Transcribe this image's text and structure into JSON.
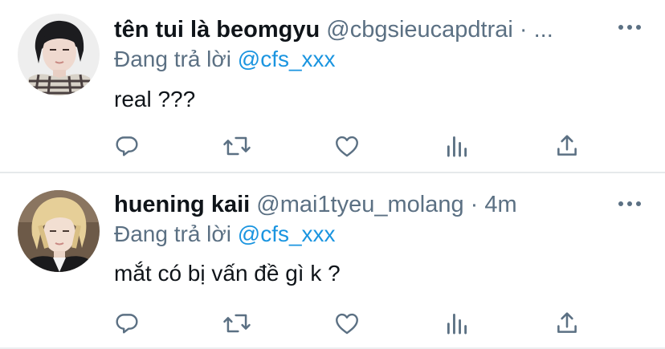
{
  "tweets": [
    {
      "display_name": "tên tui là beomgyu",
      "handle": "@cbgsieucapdtrai",
      "separator": "·",
      "timestamp": "...",
      "reply_prefix": "Đang trả lời",
      "reply_to": "@cfs_xxx",
      "text": "real ???",
      "avatar_icon": "user-avatar-photo"
    },
    {
      "display_name": "huening kaii",
      "handle": "@mai1tyeu_molang",
      "separator": "·",
      "timestamp": "4m",
      "reply_prefix": "Đang trả lời",
      "reply_to": "@cfs_xxx",
      "text": "mắt có bị vấn đề gì k ?",
      "avatar_icon": "user-avatar-photo"
    }
  ],
  "actions": [
    {
      "icon": "reply-icon"
    },
    {
      "icon": "retweet-icon"
    },
    {
      "icon": "like-icon"
    },
    {
      "icon": "analytics-icon"
    },
    {
      "icon": "share-icon"
    }
  ],
  "colors": {
    "text": "#0f1419",
    "secondary": "#5b7083",
    "link": "#1b95e0",
    "divider": "#e6e9eb"
  }
}
